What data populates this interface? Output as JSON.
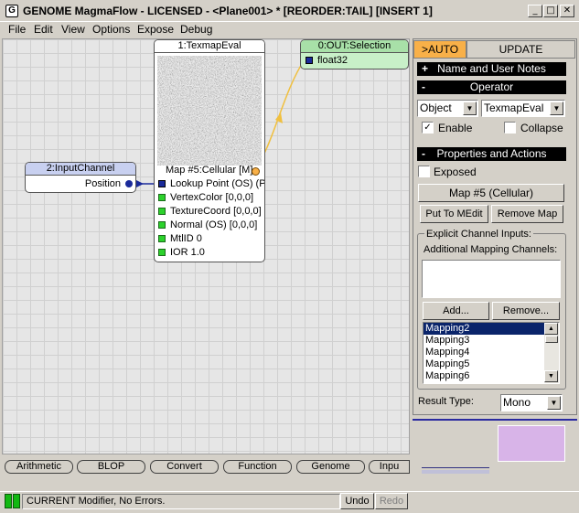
{
  "window": {
    "app_icon_glyph": "G",
    "title": "GENOME MagmaFlow - LICENSED - <Plane001> *  [REORDER:TAIL] [INSERT 1]",
    "minimize_glyph": "_",
    "maximize_glyph": "□",
    "close_glyph": "✕"
  },
  "menu": [
    "File",
    "Edit",
    "View",
    "Options",
    "Expose",
    "Debug"
  ],
  "nodes": {
    "texmap": {
      "title": "1:TexmapEval",
      "map_output": "Map #5:Cellular [M]",
      "inputs": [
        "Lookup Point (OS) (P",
        "VertexColor [0,0,0]",
        "TextureCoord [0,0,0]",
        "Normal (OS) [0,0,0]",
        "MtlID 0",
        "IOR 1.0"
      ]
    },
    "out": {
      "title": "0:OUT:Selection",
      "input_label": "float32"
    },
    "input_channel": {
      "title": "2:InputChannel",
      "output_label": "Position"
    }
  },
  "panel": {
    "tabs": [
      ">AUTO",
      "UPDATE"
    ],
    "rollouts": {
      "name": "Name and User Notes",
      "operator": "Operator",
      "properties": "Properties and Actions"
    },
    "rollout_signs": {
      "collapsed": "+",
      "expanded": "-"
    },
    "object_combo": "Object",
    "operator_combo": "TexmapEval",
    "combo_arrow_glyph": "▼",
    "enable_label": "Enable",
    "enable_checked": true,
    "collapse_label": "Collapse",
    "collapse_checked": false,
    "exposed_label": "Exposed",
    "exposed_checked": false,
    "checkmark_glyph": "✓",
    "map_button": "Map #5 (Cellular)",
    "put_to_medit": "Put To MEdit",
    "remove_map": "Remove Map",
    "explicit_group": "Explicit Channel Inputs:",
    "additional_label": "Additional Mapping Channels:",
    "add_button": "Add...",
    "remove_button": "Remove...",
    "mapping_list": [
      "Mapping2",
      "Mapping3",
      "Mapping4",
      "Mapping5",
      "Mapping6"
    ],
    "selected_mapping": "Mapping2",
    "scroll_up_glyph": "▲",
    "scroll_down_glyph": "▼",
    "result_type_label": "Result Type:",
    "result_type_value": "Mono",
    "swatch_color": "#d8b4e8"
  },
  "categories": [
    "Arithmetic",
    "BLOP",
    "Convert",
    "Function",
    "Genome",
    "Inpu"
  ],
  "statusbar": {
    "message": "CURRENT Modifier, No Errors.",
    "undo": "Undo",
    "redo": "Redo"
  },
  "colors": {
    "accent_orange": "#f8b048",
    "output_node_green": "#c8f0c8",
    "node_header_blue": "#c8d0f0",
    "wire_yellow": "#f0c040",
    "wire_blue": "#1a2a9a",
    "socket_green": "#2cd22c"
  }
}
